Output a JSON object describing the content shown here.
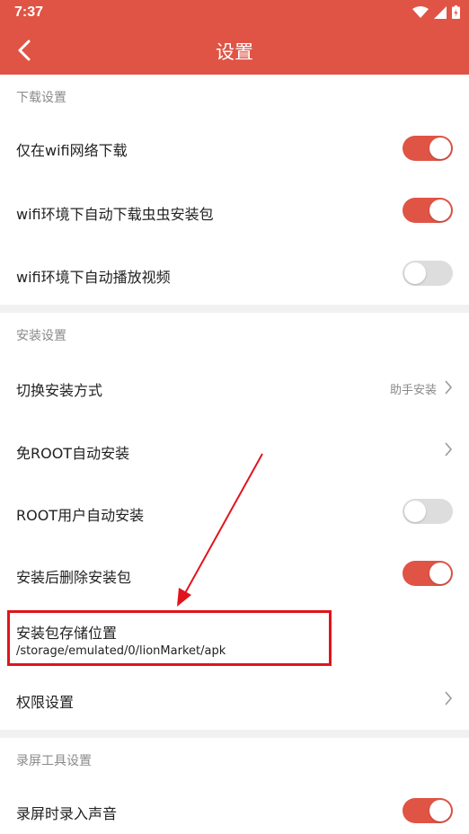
{
  "status_bar": {
    "time": "7:37"
  },
  "header": {
    "title": "设置"
  },
  "sections": {
    "download": {
      "title": "下载设置",
      "items": [
        {
          "label": "仅在wifi网络下载",
          "toggle": "on"
        },
        {
          "label": "wifi环境下自动下载虫虫安装包",
          "toggle": "on"
        },
        {
          "label": "wifi环境下自动播放视频",
          "toggle": "off"
        }
      ]
    },
    "install": {
      "title": "安装设置",
      "switch_method": {
        "label": "切换安装方式",
        "value": "助手安装"
      },
      "root_free": {
        "label": "免ROOT自动安装"
      },
      "root_user": {
        "label": "ROOT用户自动安装",
        "toggle": "off"
      },
      "delete_after": {
        "label": "安装后删除安装包",
        "toggle": "on"
      },
      "storage": {
        "label": "安装包存储位置",
        "path": "/storage/emulated/0/lionMarket/apk"
      },
      "permissions": {
        "label": "权限设置"
      }
    },
    "screen_record": {
      "title": "录屏工具设置",
      "items": [
        {
          "label": "录屏时录入声音",
          "toggle": "on"
        }
      ]
    }
  },
  "colors": {
    "accent": "#e05445",
    "highlight": "#e0151c",
    "toggle_off": "#dddddd"
  }
}
